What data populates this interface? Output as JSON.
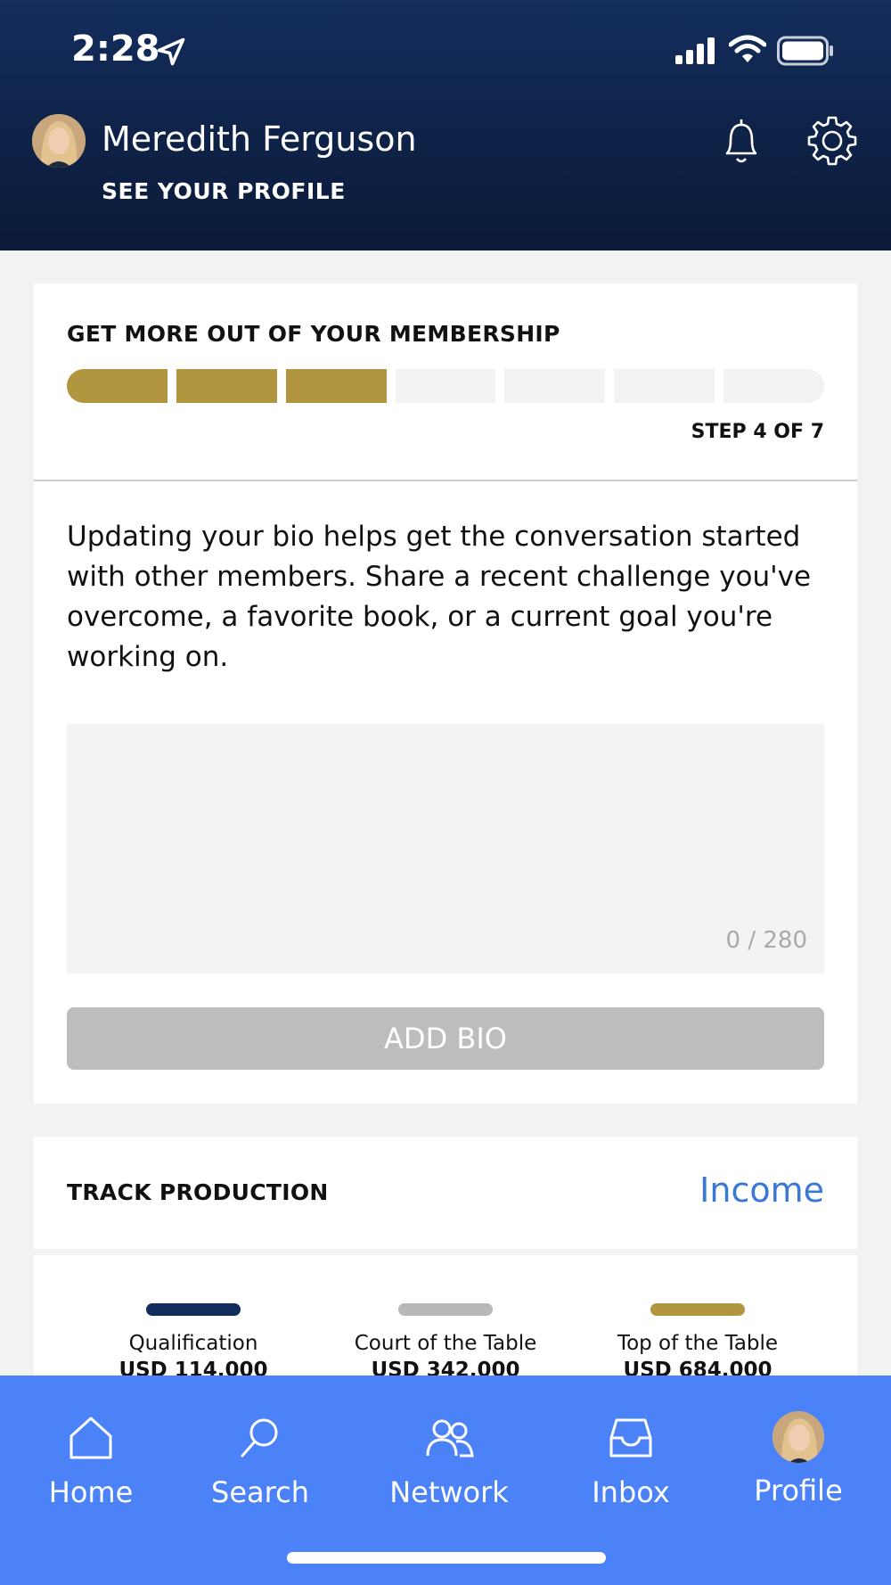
{
  "status_bar": {
    "time": "2:28"
  },
  "header": {
    "user_name": "Meredith Ferguson",
    "see_profile": "SEE YOUR PROFILE"
  },
  "membership": {
    "title": "GET MORE OUT OF YOUR MEMBERSHIP",
    "steps_total": 7,
    "steps_completed": 3,
    "step_label": "STEP 4 OF 7",
    "prompt": "Updating your bio helps get the conversation started with other members. Share a recent challenge you've overcome, a favorite book, or a current goal you're working on.",
    "bio_value": "",
    "char_count": "0 / 280",
    "add_bio_label": "ADD BIO"
  },
  "track": {
    "title": "TRACK PRODUCTION",
    "income_link": "Income"
  },
  "levels": [
    {
      "name": "Qualification",
      "value": "USD 114,000",
      "color": "#132d5c"
    },
    {
      "name": "Court of the Table",
      "value": "USD 342,000",
      "color": "#b8b8b8"
    },
    {
      "name": "Top of the Table",
      "value": "USD 684,000",
      "color": "#b2953f"
    }
  ],
  "tabs": [
    {
      "label": "Home",
      "icon": "home-icon"
    },
    {
      "label": "Search",
      "icon": "search-icon"
    },
    {
      "label": "Network",
      "icon": "people-icon"
    },
    {
      "label": "Inbox",
      "icon": "inbox-icon"
    },
    {
      "label": "Profile",
      "icon": "avatar"
    }
  ],
  "colors": {
    "accent_gold": "#b2953f",
    "header_navy": "#132d5c",
    "tabbar_blue": "#4b82f7",
    "link_blue": "#3a78d8"
  }
}
